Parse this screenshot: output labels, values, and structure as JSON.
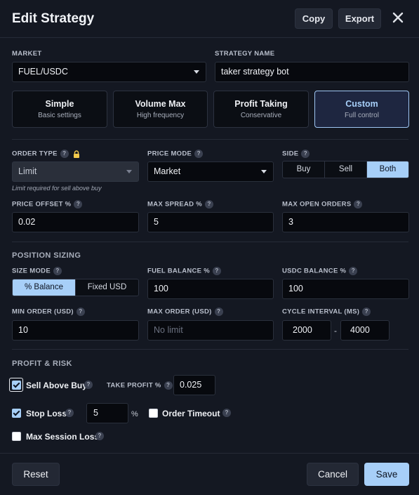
{
  "header": {
    "title": "Edit Strategy",
    "copy_label": "Copy",
    "export_label": "Export",
    "close_glyph": "✕"
  },
  "market": {
    "label": "MARKET",
    "value": "FUEL/USDC"
  },
  "strategy_name": {
    "label": "STRATEGY NAME",
    "value": "taker strategy bot"
  },
  "presets": [
    {
      "title": "Simple",
      "subtitle": "Basic settings",
      "active": false
    },
    {
      "title": "Volume Max",
      "subtitle": "High frequency",
      "active": false
    },
    {
      "title": "Profit Taking",
      "subtitle": "Conservative",
      "active": false
    },
    {
      "title": "Custom",
      "subtitle": "Full control",
      "active": true
    }
  ],
  "order_type": {
    "label": "ORDER TYPE",
    "value": "Limit",
    "hint": "Limit required for sell above buy",
    "lock_icon": "lock-icon"
  },
  "price_mode": {
    "label": "PRICE MODE",
    "value": "Market"
  },
  "side": {
    "label": "SIDE",
    "options": [
      "Buy",
      "Sell",
      "Both"
    ],
    "selected": "Both"
  },
  "price_offset": {
    "label": "PRICE OFFSET %",
    "value": "0.02"
  },
  "max_spread": {
    "label": "MAX SPREAD %",
    "value": "5"
  },
  "max_open_orders": {
    "label": "MAX OPEN ORDERS",
    "value": "3"
  },
  "position_sizing": {
    "title": "POSITION SIZING",
    "size_mode": {
      "label": "SIZE MODE",
      "options": [
        "% Balance",
        "Fixed USD"
      ],
      "selected": "% Balance"
    },
    "fuel_balance": {
      "label": "FUEL BALANCE %",
      "value": "100"
    },
    "usdc_balance": {
      "label": "USDC BALANCE %",
      "value": "100"
    },
    "min_order": {
      "label": "MIN ORDER (USD)",
      "value": "10"
    },
    "max_order": {
      "label": "MAX ORDER (USD)",
      "placeholder": "No limit"
    },
    "cycle_interval": {
      "label": "CYCLE INTERVAL (MS)",
      "min": "2000",
      "separator": "-",
      "max": "4000"
    }
  },
  "profit_risk": {
    "title": "PROFIT & RISK",
    "sell_above_buy": {
      "label": "Sell Above Buy",
      "checked": true
    },
    "take_profit": {
      "label": "TAKE PROFIT %",
      "value": "0.025"
    },
    "stop_loss": {
      "label": "Stop Loss",
      "checked": true,
      "value": "5",
      "unit": "%"
    },
    "order_timeout": {
      "label": "Order Timeout",
      "checked": false
    },
    "max_session_loss": {
      "label": "Max Session Loss",
      "checked": false
    }
  },
  "footer": {
    "reset_label": "Reset",
    "cancel_label": "Cancel",
    "save_label": "Save"
  },
  "help_glyph": "?",
  "colors": {
    "accent": "#a7cff8",
    "background": "#141822",
    "input_bg": "#07090e",
    "border": "#2c3240"
  }
}
